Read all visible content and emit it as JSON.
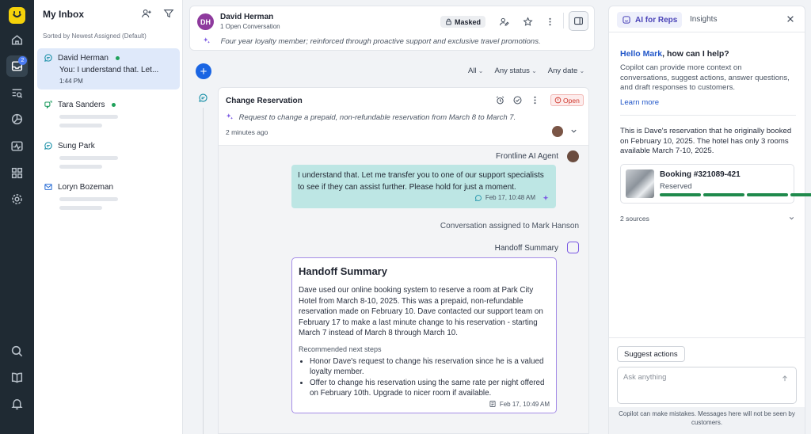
{
  "nav": {
    "badge_count": "2"
  },
  "inbox": {
    "title": "My Inbox",
    "sorted_label": "Sorted by Newest Assigned (Default)",
    "conversations": [
      {
        "name": "David Herman",
        "preview": "You: I understand that. Let...",
        "time": "1:44 PM",
        "online": true,
        "channel": "chat"
      },
      {
        "name": "Tara Sanders",
        "online": true,
        "channel": "chat"
      },
      {
        "name": "Sung Park",
        "online": false,
        "channel": "chat"
      },
      {
        "name": "Loryn Bozeman",
        "online": false,
        "channel": "email"
      }
    ]
  },
  "conversation": {
    "avatar_initials": "DH",
    "customer_name": "David Herman",
    "open_count": "1 Open Conversation",
    "masked_label": "Masked",
    "customer_summary": "Four year loyalty member; reinforced through proactive support and exclusive travel promotions."
  },
  "filters": {
    "all": "All",
    "status": "Any status",
    "date": "Any date"
  },
  "ticket": {
    "title": "Change Reservation",
    "status": "Open",
    "request": "Request to change a prepaid, non-refundable reservation from March 8 to March 7.",
    "age": "2 minutes ago"
  },
  "thread": {
    "agent_name": "Frontline AI Agent",
    "agent_message": "I understand that. Let me transfer you to one of our support specialists to see if they can assist further. Please hold for just a moment.",
    "agent_time": "Feb 17, 10:48 AM",
    "assignment": "Conversation assigned to Mark Hanson",
    "handoff_label": "Handoff Summary",
    "handoff": {
      "title": "Handoff Summary",
      "body": "Dave used our online booking system to reserve a room at Park City Hotel from March 8-10, 2025. This was a prepaid, non-refundable reservation made on February 10. Dave contacted our support team on February 17 to make a last minute change to his reservation - starting March 7 instead of March 8 through March 10.",
      "steps_label": "Recommended next steps",
      "steps": [
        "Honor Dave's request to change his reservation since he is a valued loyalty member.",
        "Offer to change his reservation using the same rate per night offered on February 10th. Upgrade to nicer room if available."
      ],
      "time": "Feb 17, 10:49 AM"
    }
  },
  "copilot": {
    "tab_ai": "AI for Reps",
    "tab_insights": "Insights",
    "greeting_name": "Hello Mark",
    "greeting_rest": ", how can I help?",
    "intro": "Copilot can provide more context on conversations, suggest actions, answer questions, and draft responses to customers.",
    "learn_more": "Learn more",
    "message": "This is Dave's reservation that he originally booked on February 10, 2025. The hotel has only 3 rooms available March 7-10, 2025.",
    "booking_number": "Booking #321089-421",
    "booking_status": "Reserved",
    "booking_progress_steps": 4,
    "sources": "2 sources",
    "suggest_actions": "Suggest actions",
    "ask_placeholder": "Ask anything",
    "disclaimer": "Copilot can make mistakes. Messages here will not be seen by customers."
  },
  "colors": {
    "accent": "#1a65e3",
    "rail": "#1f2a33",
    "ai_border": "#a58de6",
    "agent_bubble": "#bde6e4",
    "open_red": "#d03a2f",
    "success": "#1f8a4c"
  }
}
